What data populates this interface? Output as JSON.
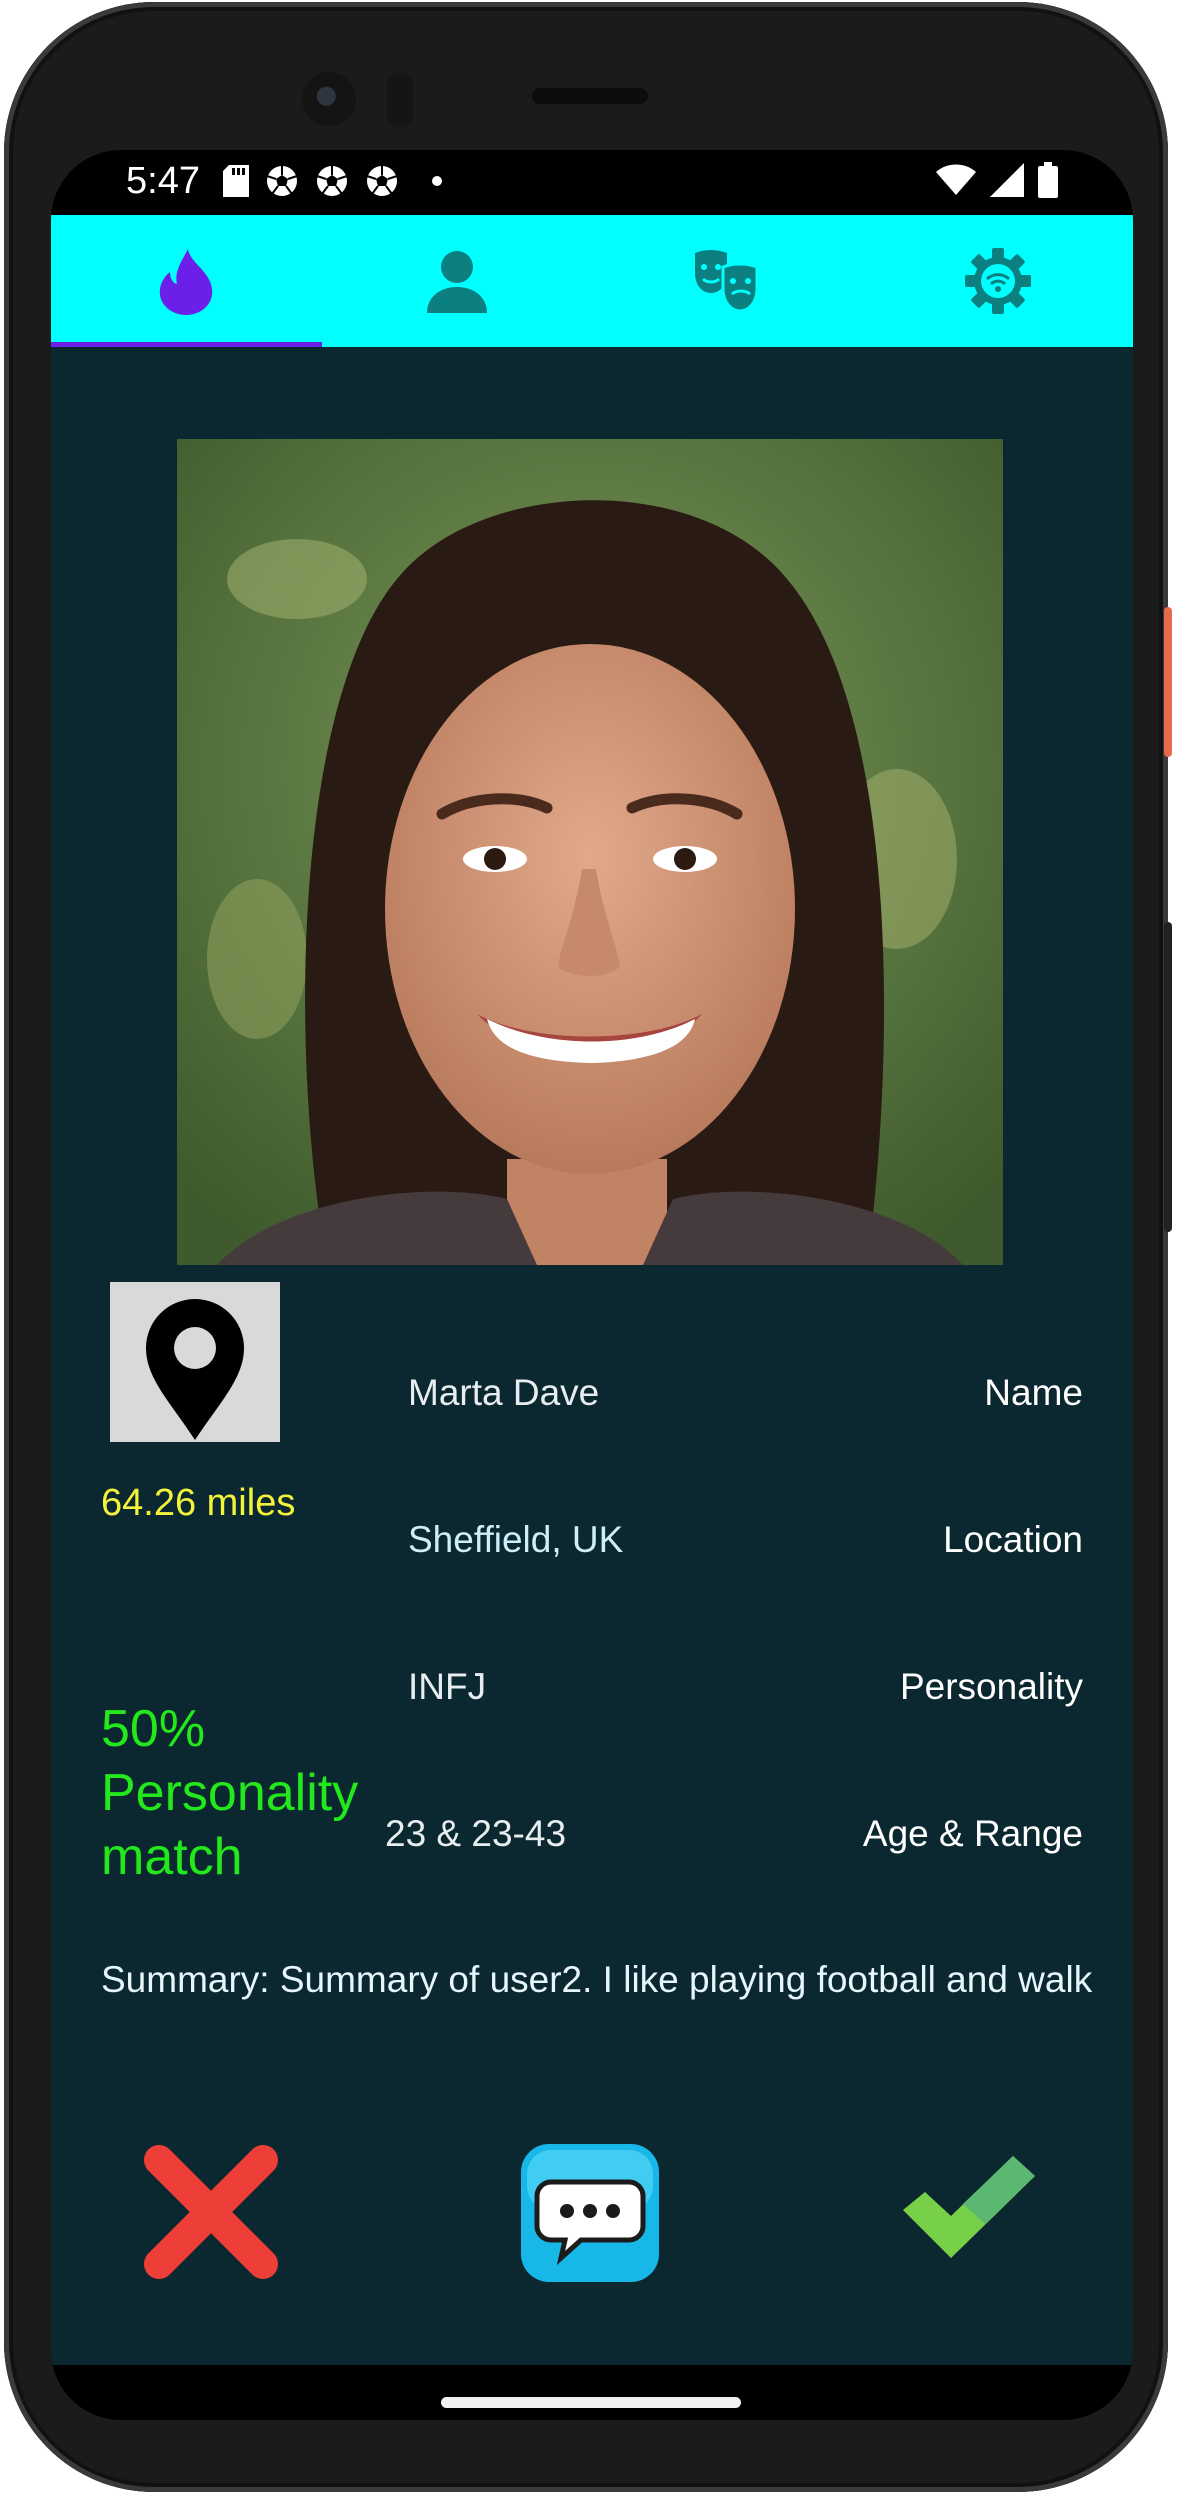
{
  "status_bar": {
    "time": "5:47",
    "left_icons": [
      "sd-card-icon",
      "soccer-ball-icon",
      "soccer-ball-icon",
      "soccer-ball-icon",
      "dot-icon"
    ],
    "right_icons": [
      "wifi-icon",
      "cellular-signal-icon",
      "battery-icon"
    ]
  },
  "tabs": [
    {
      "icon": "flame-icon",
      "selected": true
    },
    {
      "icon": "person-icon",
      "selected": false
    },
    {
      "icon": "theater-masks-icon",
      "selected": false
    },
    {
      "icon": "wireless-settings-icon",
      "selected": false
    }
  ],
  "colors": {
    "tab_bar": "#00ffff",
    "content_bg": "#0b2830",
    "selected_tab": "#6b1fe8",
    "tab_icon": "#0c8080",
    "distance_text": "#f3f33a",
    "match_text": "#22e81c"
  },
  "profile": {
    "photo_icon": "portrait-photo",
    "location_icon": "map-pin-icon",
    "distance": "64.26 miles",
    "match": "50% Personality match",
    "name_value": "Marta Dave",
    "name_label": "Name",
    "location_value": "Sheffield, UK",
    "location_label": "Location",
    "personality_value": "INFJ",
    "personality_label": "Personality",
    "age_value": "23 & 23-43",
    "age_label": "Age & Range",
    "summary": "Summary: Summary of user2. I like playing football and walk"
  },
  "actions": {
    "reject_icon": "close-x-icon",
    "chat_icon": "chat-bubble-icon",
    "accept_icon": "checkmark-icon"
  }
}
